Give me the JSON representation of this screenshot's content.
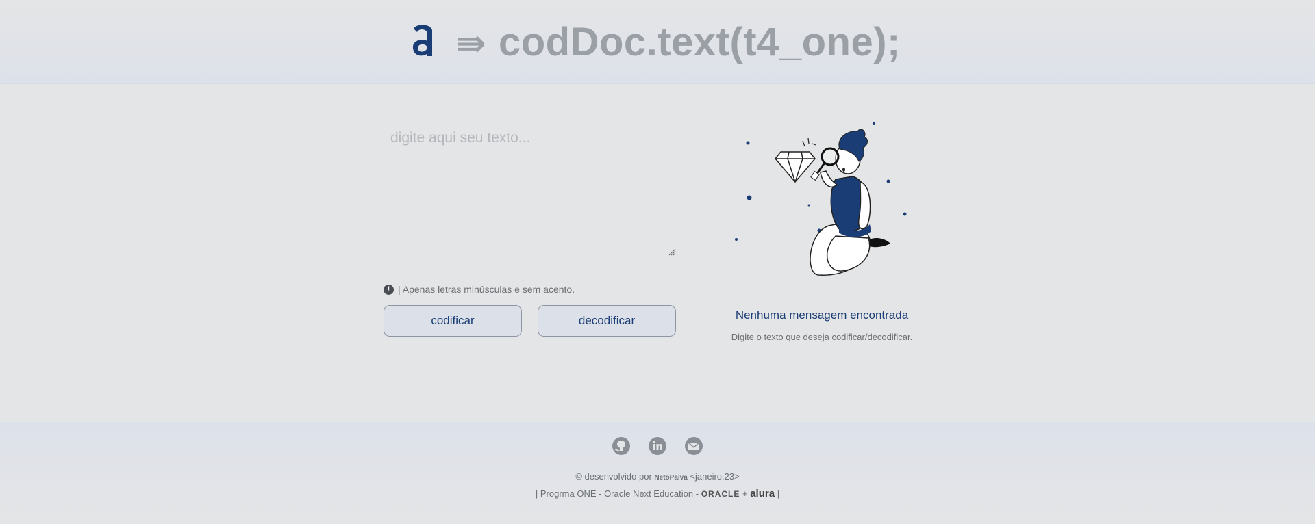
{
  "header": {
    "logo_icon": "alura-a-icon",
    "arrow": "⇛",
    "title": "codDoc.text(t4_one);"
  },
  "input": {
    "placeholder": "digite aqui seu texto...",
    "value": ""
  },
  "hint": {
    "icon": "exclamation-circle-icon",
    "text": "| Apenas letras minúsculas e sem acento."
  },
  "actions": {
    "encode_label": "codificar",
    "decode_label": "decodificar"
  },
  "result": {
    "illustration": "person-with-magnifier-and-diamond",
    "empty_title": "Nenhuma mensagem encontrada",
    "empty_subtitle": "Digite o texto que deseja codificar/decodificar."
  },
  "footer": {
    "social": [
      "github-icon",
      "linkedin-icon",
      "mail-icon"
    ],
    "credit_prefix": "© desenvolvido por",
    "author": "NetoPaiva",
    "date": "<janeiro.23>",
    "program_prefix": "| Progrma ONE - Oracle Next Education -",
    "oracle": "ORACLE",
    "plus": "+",
    "alura": "alura",
    "program_suffix": "|"
  },
  "colors": {
    "accent": "#1a3d75",
    "muted": "#9aa0a6",
    "background": "#e4e5e6"
  }
}
